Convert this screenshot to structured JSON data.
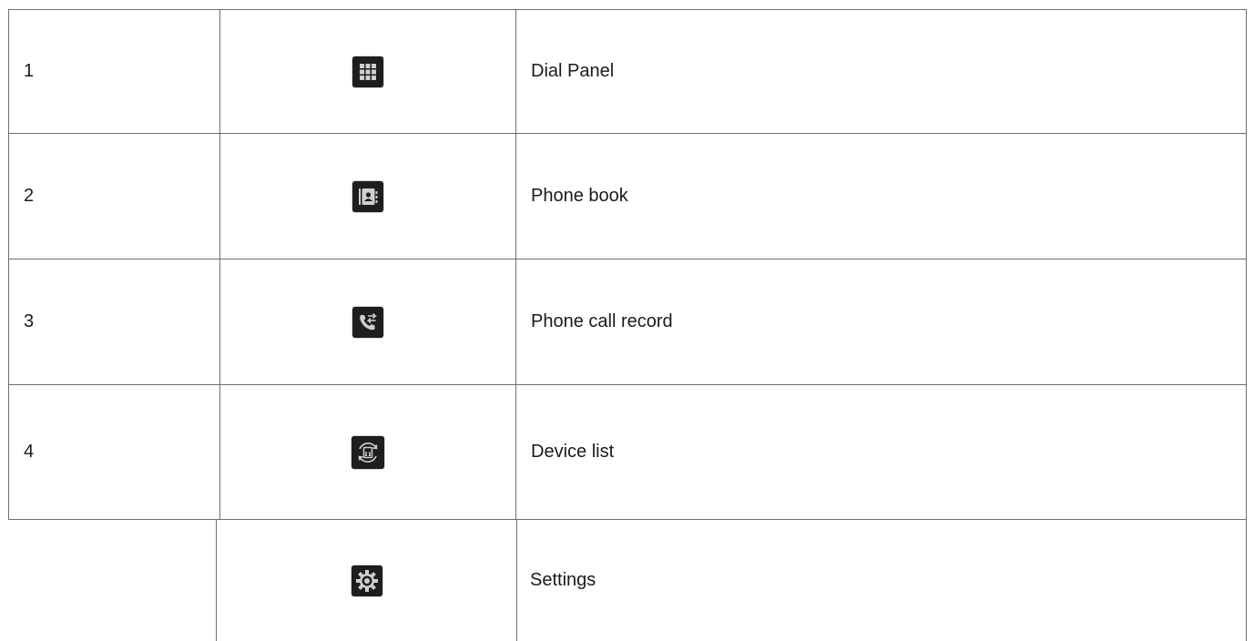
{
  "rows": [
    {
      "number": "1",
      "icon": "dial-panel-icon",
      "label": "Dial Panel"
    },
    {
      "number": "2",
      "icon": "phone-book-icon",
      "label": "Phone book"
    },
    {
      "number": "3",
      "icon": "call-record-icon",
      "label": "Phone call record"
    },
    {
      "number": "4",
      "icon": "device-list-icon",
      "label": "Device list"
    },
    {
      "number": "",
      "icon": "settings-icon",
      "label": "Settings"
    }
  ],
  "colors": {
    "icon_background": "#1e1e1e",
    "icon_foreground": "#cfcfcf",
    "border": "#6e6e6e"
  }
}
